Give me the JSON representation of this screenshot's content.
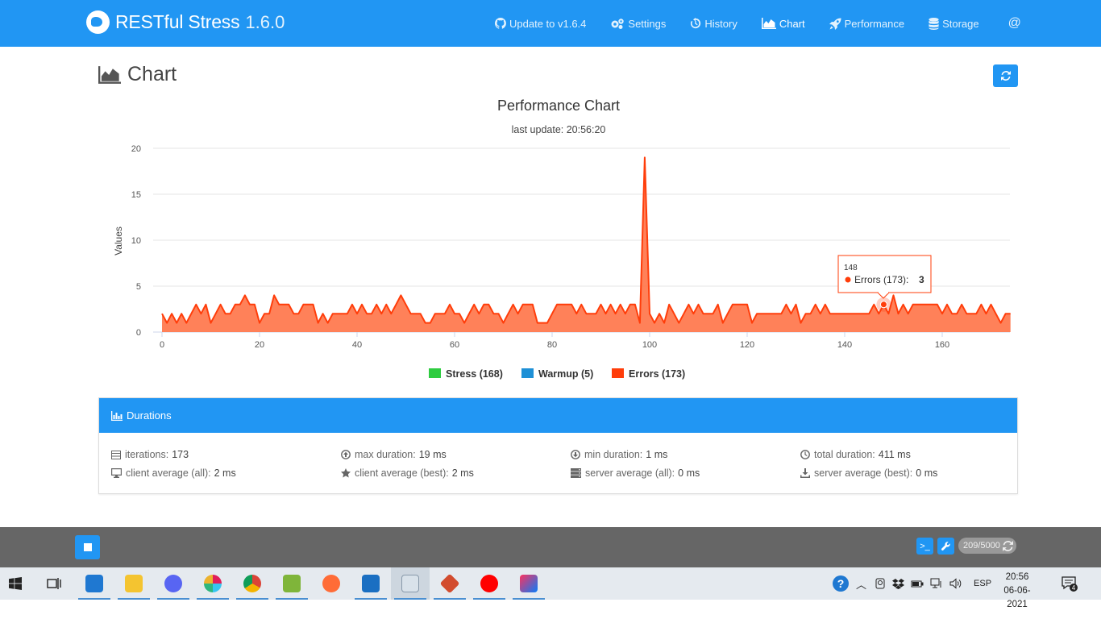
{
  "navbar": {
    "brand_name": "RESTful Stress",
    "brand_version": "1.6.0",
    "items": [
      {
        "label": "Update to v1.6.4",
        "icon": "github-icon"
      },
      {
        "label": "Settings",
        "icon": "gears-icon"
      },
      {
        "label": "History",
        "icon": "history-icon"
      },
      {
        "label": "Chart",
        "icon": "area-chart-icon",
        "active": true
      },
      {
        "label": "Performance",
        "icon": "rocket-icon"
      },
      {
        "label": "Storage",
        "icon": "database-icon"
      }
    ],
    "at_label": "@"
  },
  "page": {
    "title": "Chart",
    "refresh_icon": "refresh-icon"
  },
  "chart_data": {
    "type": "area",
    "title": "Performance Chart",
    "subtitle": "last update: 20:56:20",
    "ylabel": "Values",
    "xlabel": "",
    "ylim": [
      0,
      20
    ],
    "xlim": [
      0,
      173
    ],
    "yticks": [
      0,
      5,
      10,
      15,
      20
    ],
    "xticks": [
      0,
      20,
      40,
      60,
      80,
      100,
      120,
      140,
      160
    ],
    "grid": true,
    "legend_position": "bottom",
    "series": [
      {
        "name": "Stress (168)",
        "color": "#2ecc40",
        "values": []
      },
      {
        "name": "Warmup (5)",
        "color": "#1e90d6",
        "values": []
      },
      {
        "name": "Errors (173)",
        "color": "#ff3d0a",
        "fill": "#ff7a50",
        "values": [
          2,
          1,
          2,
          1,
          2,
          1,
          2,
          3,
          2,
          3,
          1,
          2,
          3,
          2,
          2,
          3,
          3,
          4,
          3,
          3,
          1,
          2,
          2,
          4,
          3,
          3,
          3,
          2,
          2,
          3,
          3,
          3,
          1,
          2,
          1,
          2,
          2,
          2,
          2,
          3,
          2,
          3,
          2,
          2,
          3,
          2,
          3,
          2,
          3,
          4,
          3,
          2,
          2,
          2,
          1,
          1,
          2,
          2,
          2,
          3,
          2,
          2,
          1,
          2,
          3,
          2,
          3,
          3,
          2,
          2,
          1,
          2,
          3,
          2,
          3,
          3,
          3,
          1,
          1,
          1,
          2,
          3,
          3,
          3,
          3,
          2,
          3,
          2,
          2,
          2,
          3,
          2,
          3,
          2,
          3,
          2,
          3,
          3,
          1,
          19,
          2,
          1,
          2,
          1,
          3,
          2,
          1,
          2,
          3,
          2,
          3,
          2,
          2,
          2,
          3,
          1,
          2,
          3,
          3,
          3,
          3,
          1,
          2,
          2,
          2,
          2,
          2,
          2,
          3,
          2,
          3,
          1,
          2,
          2,
          3,
          2,
          3,
          2,
          2,
          2,
          2,
          2,
          2,
          2,
          2,
          2,
          3,
          2,
          3,
          2,
          4,
          2,
          3,
          2,
          3,
          3,
          3,
          3,
          3,
          3,
          2,
          3,
          2,
          2,
          3,
          2,
          2,
          2,
          3,
          2,
          3,
          2,
          1,
          2,
          2
        ]
      }
    ],
    "tooltip": {
      "x": 148,
      "series": "Errors (173)",
      "value": 3
    }
  },
  "tooltip_text": {
    "x_label": "148",
    "series_label": "Errors (173):",
    "value_label": "3"
  },
  "durations": {
    "title": "Durations",
    "stats": [
      {
        "icon": "list-icon",
        "label": "iterations:",
        "value": "173"
      },
      {
        "icon": "arrow-circle-up-icon",
        "label": "max duration:",
        "value": "19 ms"
      },
      {
        "icon": "arrow-circle-down-icon",
        "label": "min duration:",
        "value": "1 ms"
      },
      {
        "icon": "clock-icon",
        "label": "total duration:",
        "value": "411 ms"
      },
      {
        "icon": "desktop-icon",
        "label": "client average (all):",
        "value": "2 ms"
      },
      {
        "icon": "star-icon",
        "label": "client average (best):",
        "value": "2 ms"
      },
      {
        "icon": "server-icon",
        "label": "server average (all):",
        "value": "0 ms"
      },
      {
        "icon": "download-icon",
        "label": "server average (best):",
        "value": "0 ms"
      }
    ]
  },
  "footer": {
    "counter": "209/5000",
    "terminal_label": ">_",
    "wrench_icon": "wrench-icon"
  },
  "taskbar": {
    "language": "ESP",
    "time": "20:56",
    "date": "06-06-2021",
    "notification_count": "4"
  }
}
